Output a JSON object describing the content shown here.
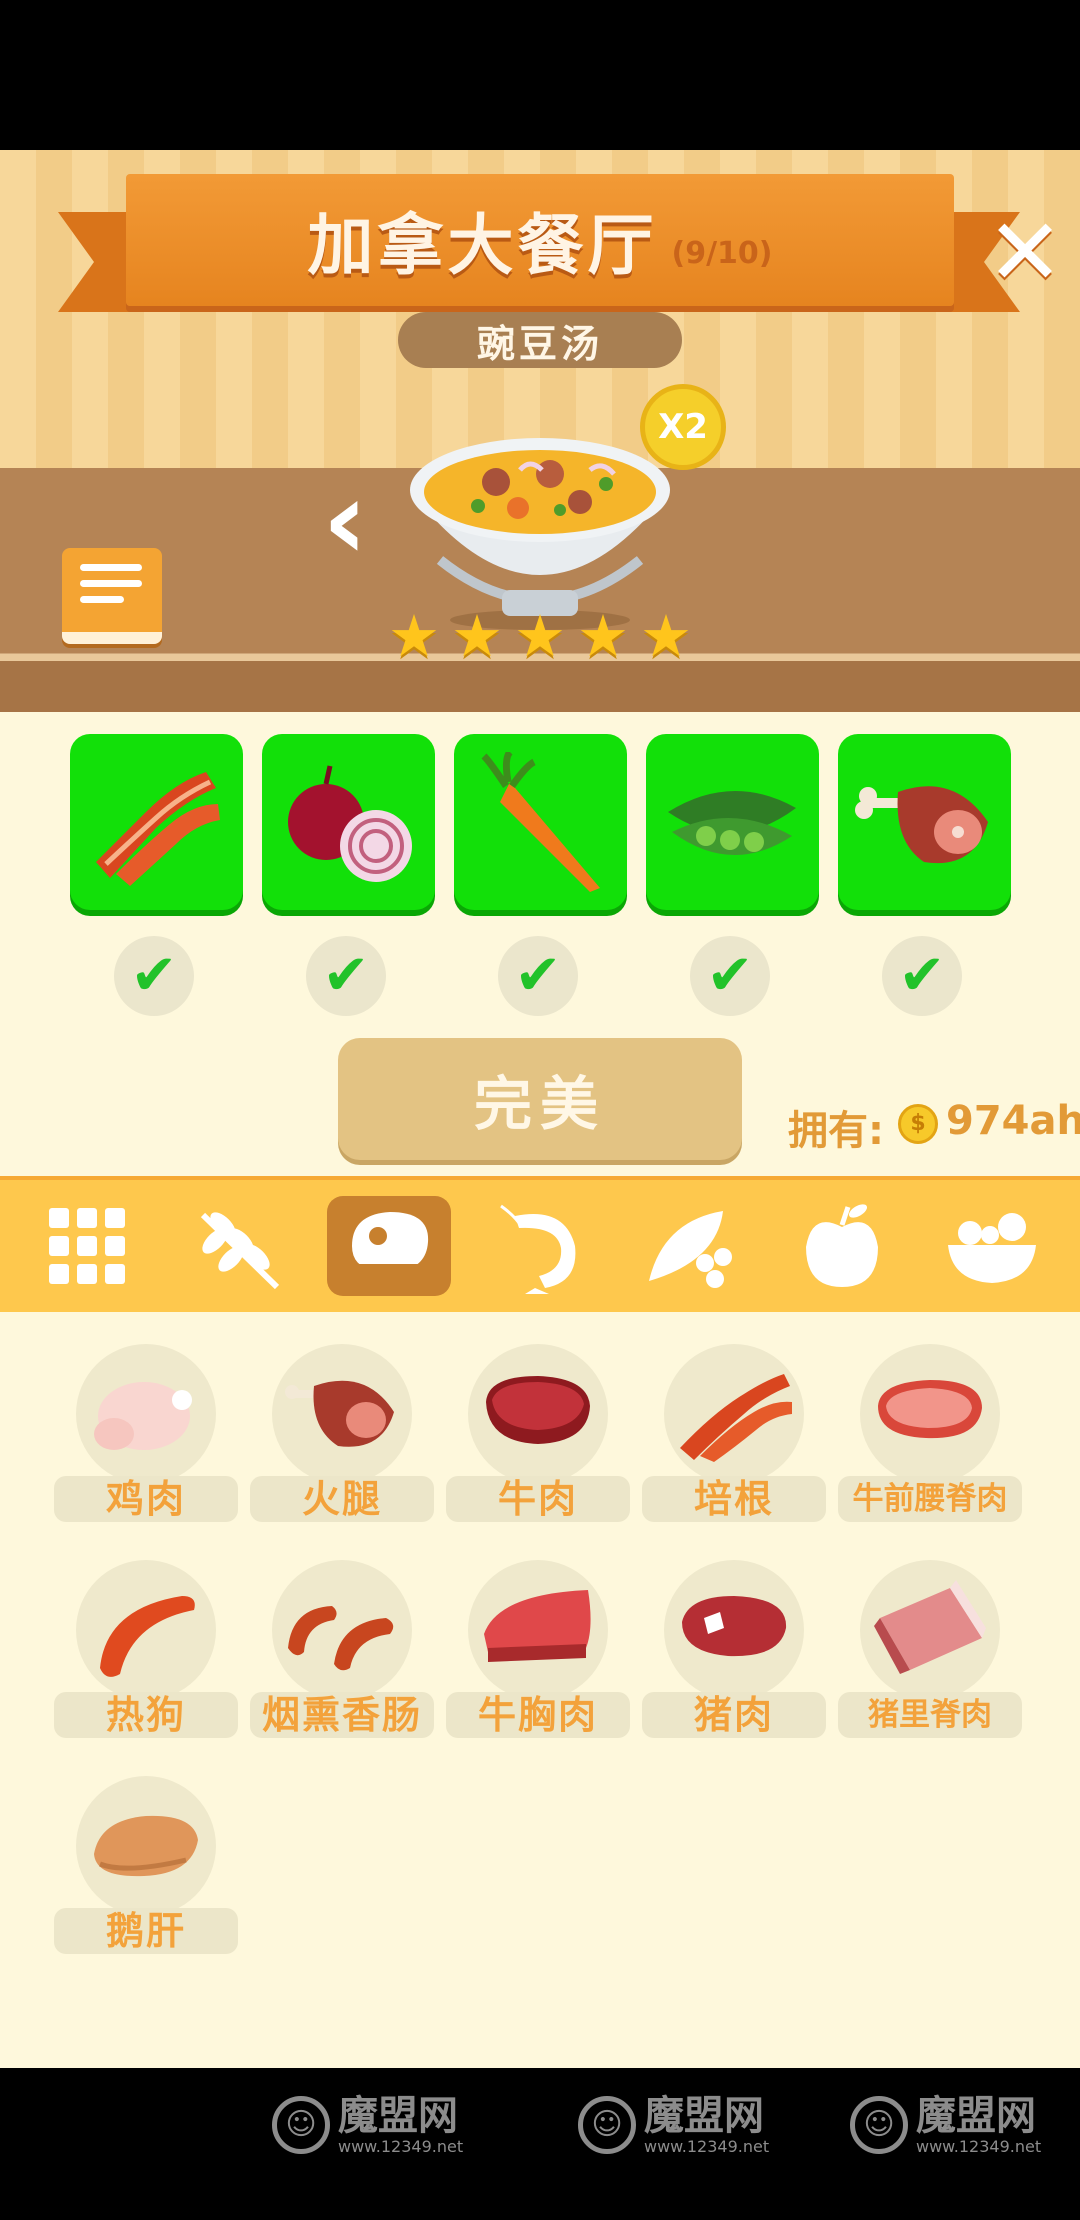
{
  "header": {
    "title": "加拿大餐厅",
    "progress": "(9/10)",
    "close_symbol": "✕",
    "dish_name": "豌豆汤",
    "multiplier": "X2",
    "back_symbol": "‹",
    "rating_stars": 5,
    "star_symbol": "★"
  },
  "ingredients": [
    {
      "name": "bacon",
      "checked": true
    },
    {
      "name": "onion",
      "checked": true
    },
    {
      "name": "carrot",
      "checked": true
    },
    {
      "name": "pea-pod",
      "checked": true
    },
    {
      "name": "ham",
      "checked": true
    }
  ],
  "check_symbol": "✔",
  "result": {
    "button_label": "完美",
    "owned_label": "拥有:",
    "coin_symbol": "$",
    "owned_value": "974ah"
  },
  "categories": [
    {
      "icon": "grid-icon",
      "active": false
    },
    {
      "icon": "wheat-icon",
      "active": false
    },
    {
      "icon": "meat-icon",
      "active": true
    },
    {
      "icon": "shrimp-icon",
      "active": false
    },
    {
      "icon": "peas-icon",
      "active": false
    },
    {
      "icon": "apple-icon",
      "active": false
    },
    {
      "icon": "salad-icon",
      "active": false
    }
  ],
  "foods": [
    {
      "label": "鸡肉"
    },
    {
      "label": "火腿"
    },
    {
      "label": "牛肉"
    },
    {
      "label": "培根"
    },
    {
      "label": "牛前腰脊肉"
    },
    {
      "label": "热狗"
    },
    {
      "label": "烟熏香肠"
    },
    {
      "label": "牛胸肉"
    },
    {
      "label": "猪肉"
    },
    {
      "label": "猪里脊肉"
    },
    {
      "label": "鹅肝"
    }
  ],
  "watermark": {
    "logo_text": "☺",
    "name": "魔盟网",
    "url": "www.12349.net"
  },
  "colors": {
    "ribbon": "#e6841f",
    "ingredient_tile": "#12e009",
    "category_bar": "#fec84d",
    "label_text": "#f3a23b"
  }
}
